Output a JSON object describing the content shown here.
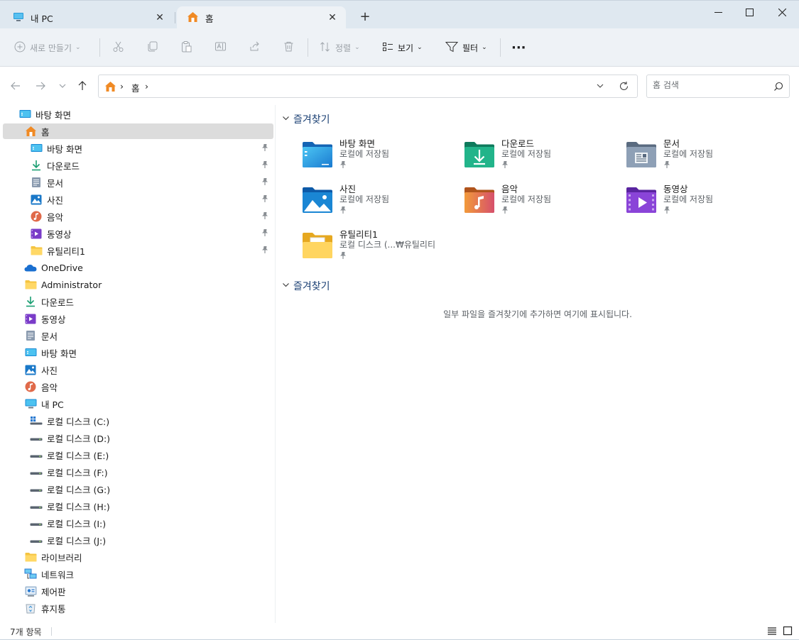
{
  "tabs": [
    {
      "label": "내 PC",
      "icon": "pc-icon"
    },
    {
      "label": "홈",
      "icon": "home-icon",
      "active": true
    }
  ],
  "toolbar": {
    "new_label": "새로 만들기",
    "sort_label": "정렬",
    "view_label": "보기",
    "filter_label": "필터",
    "more_label": "···"
  },
  "address": {
    "crumbs": [
      "홈"
    ]
  },
  "search": {
    "placeholder": "홈 검색"
  },
  "sidebar": {
    "items": [
      {
        "label": "바탕 화면",
        "icon": "desktop-icon"
      },
      {
        "label": "홈",
        "icon": "home-icon",
        "selected": true
      },
      {
        "label": "바탕 화면",
        "icon": "desktop-icon",
        "pinned": true
      },
      {
        "label": "다운로드",
        "icon": "download-icon",
        "pinned": true
      },
      {
        "label": "문서",
        "icon": "documents-icon",
        "pinned": true
      },
      {
        "label": "사진",
        "icon": "pictures-icon",
        "pinned": true
      },
      {
        "label": "음악",
        "icon": "music-icon",
        "pinned": true
      },
      {
        "label": "동영상",
        "icon": "videos-icon",
        "pinned": true
      },
      {
        "label": "유틸리티1",
        "icon": "folder-icon",
        "pinned": true
      },
      {
        "label": "OneDrive",
        "icon": "onedrive-icon"
      },
      {
        "label": "Administrator",
        "icon": "folder-icon"
      },
      {
        "label": "다운로드",
        "icon": "download-icon"
      },
      {
        "label": "동영상",
        "icon": "videos-icon"
      },
      {
        "label": "문서",
        "icon": "documents-icon"
      },
      {
        "label": "바탕 화면",
        "icon": "desktop-icon"
      },
      {
        "label": "사진",
        "icon": "pictures-icon"
      },
      {
        "label": "음악",
        "icon": "music-icon"
      },
      {
        "label": "내 PC",
        "icon": "pc-icon"
      },
      {
        "label": "로컬 디스크 (C:)",
        "icon": "system-drive-icon"
      },
      {
        "label": "로컬 디스크 (D:)",
        "icon": "drive-icon"
      },
      {
        "label": "로컬 디스크 (E:)",
        "icon": "drive-icon"
      },
      {
        "label": "로컬 디스크 (F:)",
        "icon": "drive-icon"
      },
      {
        "label": "로컬 디스크 (G:)",
        "icon": "drive-icon"
      },
      {
        "label": "로컬 디스크 (H:)",
        "icon": "drive-icon"
      },
      {
        "label": "로컬 디스크 (I:)",
        "icon": "drive-icon"
      },
      {
        "label": "로컬 디스크 (J:)",
        "icon": "drive-icon"
      },
      {
        "label": "라이브러리",
        "icon": "folder-icon"
      },
      {
        "label": "네트워크",
        "icon": "network-icon"
      },
      {
        "label": "제어판",
        "icon": "control-panel-icon"
      },
      {
        "label": "휴지통",
        "icon": "recycle-bin-icon"
      }
    ]
  },
  "main": {
    "favorites_title": "즐겨찾기",
    "recent_title": "즐겨찾기",
    "empty_message": "일부 파일을 즐겨찾기에 추가하면 여기에 표시됩니다.",
    "folders": [
      {
        "name": "바탕 화면",
        "location": "로컬에 저장됨",
        "icon": "desktop-icon"
      },
      {
        "name": "다운로드",
        "location": "로컬에 저장됨",
        "icon": "download-icon"
      },
      {
        "name": "문서",
        "location": "로컬에 저장됨",
        "icon": "documents-icon"
      },
      {
        "name": "사진",
        "location": "로컬에 저장됨",
        "icon": "pictures-icon"
      },
      {
        "name": "음악",
        "location": "로컬에 저장됨",
        "icon": "music-icon"
      },
      {
        "name": "동영상",
        "location": "로컬에 저장됨",
        "icon": "videos-icon"
      },
      {
        "name": "유틸리티1",
        "location": "로컬 디스크 (...₩유틸리티",
        "icon": "folder-icon"
      }
    ]
  },
  "status": {
    "count": "7개 항목"
  },
  "colors": {
    "accent": "#0067c0",
    "tabbar_bg": "#dfe8f0",
    "toolbar_bg": "#eef2f6",
    "selected_bg": "#dcdcdc",
    "section_title": "#1a3f73"
  }
}
